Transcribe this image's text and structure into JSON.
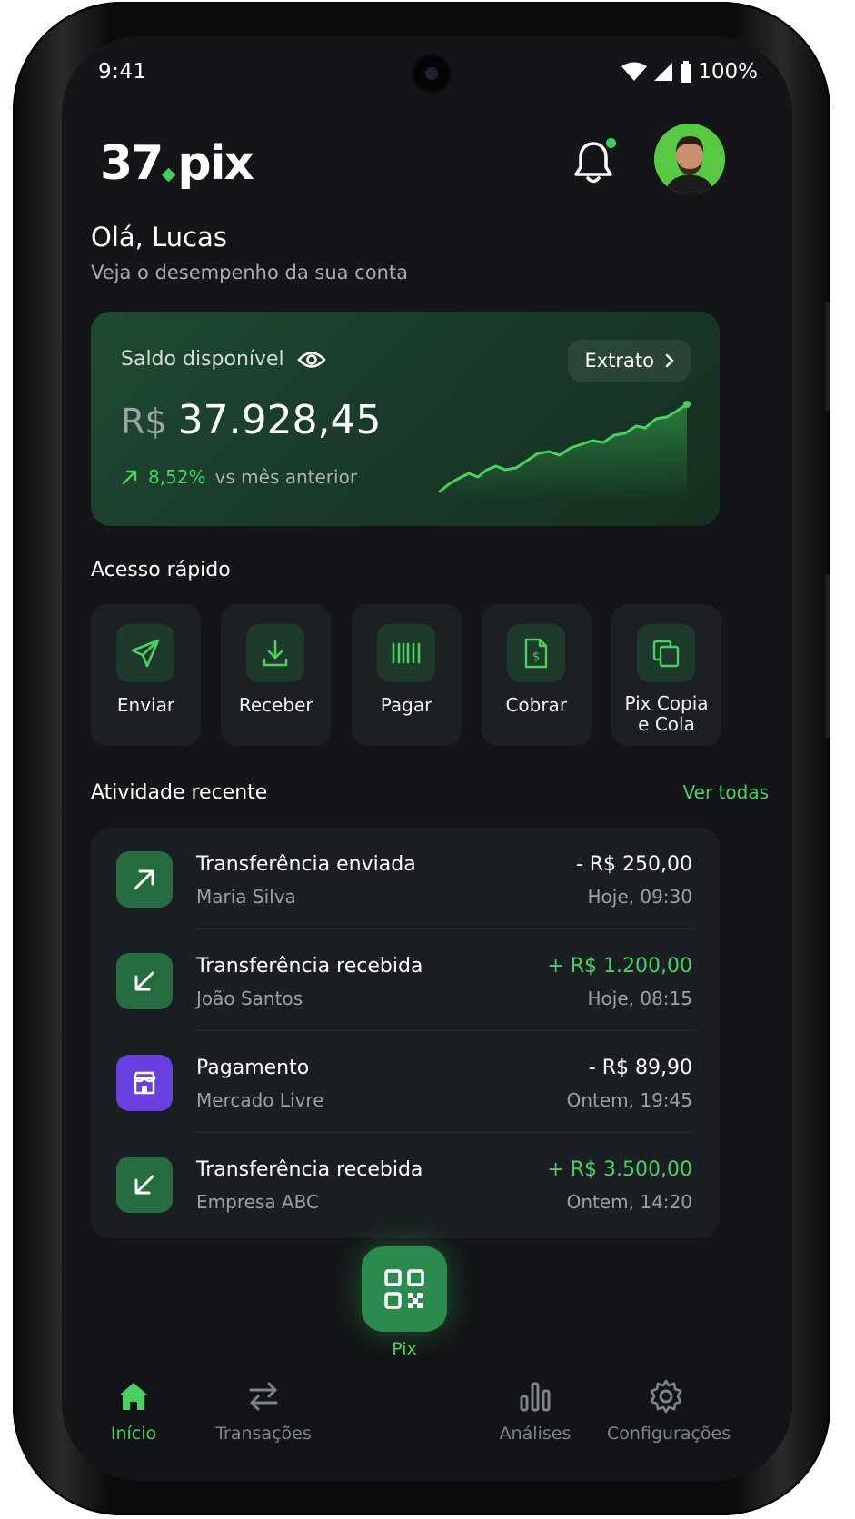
{
  "status_bar": {
    "time": "9:41",
    "battery": "100%"
  },
  "header": {
    "logo_left": "37",
    "logo_right": "pix"
  },
  "greeting": {
    "title": "Olá, Lucas",
    "subtitle": "Veja o desempenho da sua conta"
  },
  "balance": {
    "label": "Saldo disponível",
    "extrato_label": "Extrato",
    "currency": "R$",
    "amount": "37.928,45",
    "change_pct": "8,52%",
    "change_text": "vs mês anterior",
    "accent": "#4ccf5f"
  },
  "quick_access": {
    "title": "Acesso rápido",
    "items": [
      {
        "label": "Enviar",
        "icon": "send-icon"
      },
      {
        "label": "Receber",
        "icon": "download-icon"
      },
      {
        "label": "Pagar",
        "icon": "barcode-icon"
      },
      {
        "label": "Cobrar",
        "icon": "invoice-icon"
      },
      {
        "label_line1": "Pix Copia",
        "label_line2": "e Cola",
        "icon": "copy-icon"
      }
    ]
  },
  "activity": {
    "title": "Atividade recente",
    "see_all": "Ver todas",
    "items": [
      {
        "title": "Transferência enviada",
        "who": "Maria Silva",
        "amount": "- R$ 250,00",
        "when": "Hoje, 09:30",
        "icon": "arrow-up-right-icon"
      },
      {
        "title": "Transferência recebida",
        "who": "João Santos",
        "amount": "+ R$ 1.200,00",
        "when": "Hoje, 08:15",
        "icon": "arrow-down-left-icon"
      },
      {
        "title": "Pagamento",
        "who": "Mercado Livre",
        "amount": "- R$ 89,90",
        "when": "Ontem, 19:45",
        "icon": "store-icon"
      },
      {
        "title": "Transferência recebida",
        "who": "Empresa ABC",
        "amount": "+ R$ 3.500,00",
        "when": "Ontem, 14:20",
        "icon": "arrow-down-left-icon"
      }
    ]
  },
  "nav": {
    "home": "Início",
    "transactions": "Transações",
    "pix": "Pix",
    "analytics": "Análises",
    "settings": "Configurações"
  }
}
